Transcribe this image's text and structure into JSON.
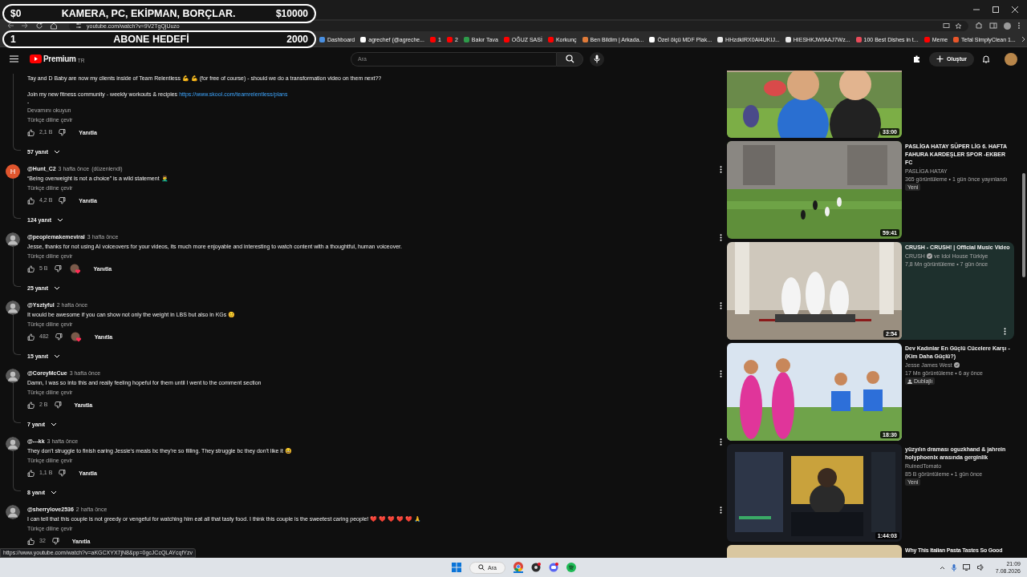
{
  "stream_overlay": {
    "goal": {
      "start": "$0",
      "title": "KAMERA, PC, EKİPMAN, BORÇLAR.",
      "target": "$10000"
    },
    "subs": {
      "start": "1",
      "title": "ABONE HEDEFİ",
      "target": "2000"
    }
  },
  "browser": {
    "url": "youtube.com/watch?v=9V2TgQjUuzo",
    "bookmarks": [
      {
        "kind": "site",
        "label": "Dashboard",
        "color": "#4a90e2"
      },
      {
        "kind": "site",
        "label": "agrechef (@agreche...",
        "color": "#ffffff"
      },
      {
        "kind": "site",
        "label": "1",
        "color": "#ff0000"
      },
      {
        "kind": "site",
        "label": "2",
        "color": "#ff0000"
      },
      {
        "kind": "site",
        "label": "Bakır Tava",
        "color": "#2e9b4a"
      },
      {
        "kind": "site",
        "label": "OĞUZ SASİ",
        "color": "#ff0000"
      },
      {
        "kind": "site",
        "label": "Korkunç",
        "color": "#ff0000"
      },
      {
        "kind": "site",
        "label": "Ben Bildim | Arkada...",
        "color": "#e07b39"
      },
      {
        "kind": "site",
        "label": "Özel ölçü MDF Plak...",
        "color": "#ffffff"
      },
      {
        "kind": "site",
        "label": "HHzdkIRX0Al4UKIJ...",
        "color": "#e8e8e8"
      },
      {
        "kind": "site",
        "label": "HIESHKJWIAAJ7Wz...",
        "color": "#e8e8e8"
      },
      {
        "kind": "site",
        "label": "100 Best Dishes in t...",
        "color": "#e84b5a"
      },
      {
        "kind": "site",
        "label": "Meme",
        "color": "#ff0000"
      },
      {
        "kind": "site",
        "label": "Tefal SimplyClean 1...",
        "color": "#e8562a"
      }
    ]
  },
  "youtube_header": {
    "logo": "Premium",
    "region": "TR",
    "search": {
      "placeholder": "Ara"
    },
    "create": "Oluştur"
  },
  "comments": [
    {
      "kind": "continued",
      "paragraphs": [
        {
          "text": "Tay and D Baby are now my clients inside of Team Relentless 💪 💪 (for free of course) - should we do a transformation video on them next??"
        },
        {
          "text": "Join my new fitness community - weekly workouts & recipies",
          "link": "https://www.skool.com/teamrelentless/plans"
        },
        {
          "text": "-"
        }
      ],
      "more": "Devamını okuyun",
      "translate": "Türkçe diline çevir",
      "likes": "2,1 B",
      "hearted": false,
      "reply": "Yanıtla",
      "replies": "57 yanıt"
    },
    {
      "kind": "comment",
      "avatar": {
        "kind": "letter",
        "letter": "H",
        "color": "#e0552d"
      },
      "user": "@Hunt_C2",
      "time": "3 hafta önce",
      "edited": "(düzenlendi)",
      "text": "“Being overweight is not a choice” is a wild statement 🤦‍♂️",
      "translate": "Türkçe diline çevir",
      "likes": "4,2 B",
      "hearted": false,
      "reply": "Yanıtla",
      "replies": "124 yanıt"
    },
    {
      "kind": "comment",
      "user": "@peoplemakemeviral",
      "time": "3 hafta önce",
      "text": "Jesse, thanks for not using AI voiceovers for your videos, its much more enjoyable and interesting to watch content with a thoughtful, human voiceover.",
      "translate": "Türkçe diline çevir",
      "likes": "5 B",
      "hearted": true,
      "reply": "Yanıtla",
      "replies": "25 yanıt"
    },
    {
      "kind": "comment",
      "user": "@Ysztyful",
      "time": "2 hafta önce",
      "text": "It would be awesome if you can show not only the weight in LBS but also in KGs 😊",
      "translate": "Türkçe diline çevir",
      "likes": "482",
      "hearted": true,
      "reply": "Yanıtla",
      "replies": "15 yanıt"
    },
    {
      "kind": "comment",
      "user": "@CoreyMcCue",
      "time": "3 hafta önce",
      "text": "Damn, I was so into this and really feeling hopeful for them until I went to the comment section",
      "translate": "Türkçe diline çevir",
      "likes": "2 B",
      "hearted": false,
      "reply": "Yanıtla",
      "replies": "7 yanıt"
    },
    {
      "kind": "comment",
      "user": "@---kk",
      "time": "3 hafta önce",
      "text": "They don't struggle to finish earing Jessie's meals bc they're so filling. They struggle bc they don't like it 😆",
      "translate": "Türkçe diline çevir",
      "likes": "1,1 B",
      "hearted": false,
      "reply": "Yanıtla",
      "replies": "8 yanıt"
    },
    {
      "kind": "comment",
      "user": "@sherrylove2536",
      "time": "2 hafta önce",
      "text": "I can tell that this couple is not greedy or vengeful for watching him eat all that tasty food. I think this couple is the sweetest caring people! ❤️ ❤️ ❤️ ❤️ ❤️ 🙏",
      "translate": "Türkçe diline çevir",
      "likes": "32",
      "hearted": false,
      "reply": "Yanıtla"
    }
  ],
  "related_videos": [
    {
      "duration": "33:00",
      "selected": false
    },
    {
      "duration": "59:41",
      "title": "PASLİGA HATAY SÜPER LİG 6. HAFTA FAHURA KARDEŞLER SPOR -EKBER FC",
      "channel": "PASLİGA HATAY",
      "verified": false,
      "meta": "365 görüntüleme • 1 gün önce yayınlandı",
      "badge": {
        "kind": "new",
        "label": "Yeni"
      },
      "selected": false
    },
    {
      "duration": "2:54",
      "title": "CRUSH - CRUSH! | Official Music Video",
      "channel": "CRUSH",
      "verified": true,
      "channel_extra": "ve Idol House Türkiye",
      "meta": "7,8 Mn görüntüleme • 7 gün önce",
      "selected": true
    },
    {
      "duration": "18:30",
      "title": "Dev Kadınlar En Güçlü Cücelere Karşı - (Kim Daha Güçlü?)",
      "channel": "Jesse James West",
      "verified": true,
      "meta": "17 Mn görüntüleme • 6 ay önce",
      "badge": {
        "kind": "dubbed",
        "label": "Dublajlı"
      },
      "selected": false
    },
    {
      "duration": "1:44:03",
      "title": "yüzyılın draması oguzkhand & jahrein holyphoenix arasında gerginlik",
      "channel": "RuinedTomato",
      "verified": false,
      "meta": "85 B görüntüleme • 1 gün önce",
      "badge": {
        "kind": "new",
        "label": "Yeni"
      },
      "selected": false
    },
    {
      "title": "Why This Italian Pasta Tastes So Good",
      "selected": false
    }
  ],
  "status_url": "https://www.youtube.com/watch?v=aKGCXYX7jN8&pp=0gcJCcQLAYcqfYzv",
  "taskbar": {
    "search": "Ara",
    "time": "21:09",
    "date": "7.08.2026"
  }
}
